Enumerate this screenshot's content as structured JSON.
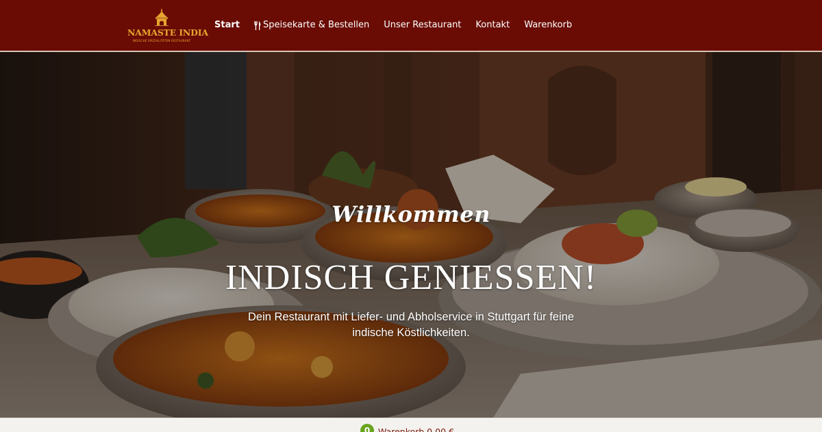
{
  "brand": {
    "name": "NAMASTE INDIA",
    "tagline": "INDISCHE SPEZIALITÄTEN RESTAURANT",
    "logo_icon": "temple-icon",
    "color_gold": "#e8a530"
  },
  "nav": {
    "items": [
      {
        "label": "Start",
        "active": true
      },
      {
        "label": "Speisekarte & Bestellen",
        "icon": "cutlery-icon"
      },
      {
        "label": "Unser Restaurant"
      },
      {
        "label": "Kontakt"
      },
      {
        "label": "Warenkorb"
      }
    ]
  },
  "hero": {
    "welcome": "Willkommen",
    "headline": "INDISCH GENIESSEN!",
    "tagline": "Dein Restaurant mit Liefer- und Abholservice in Stuttgart für feine indische Köstlichkeiten."
  },
  "cart": {
    "count": "0",
    "label": "Warenkorb 0,00 €",
    "badge_color": "#69a51f"
  },
  "theme": {
    "header_bg": "#6a0c04",
    "text_light": "#ffffff"
  }
}
